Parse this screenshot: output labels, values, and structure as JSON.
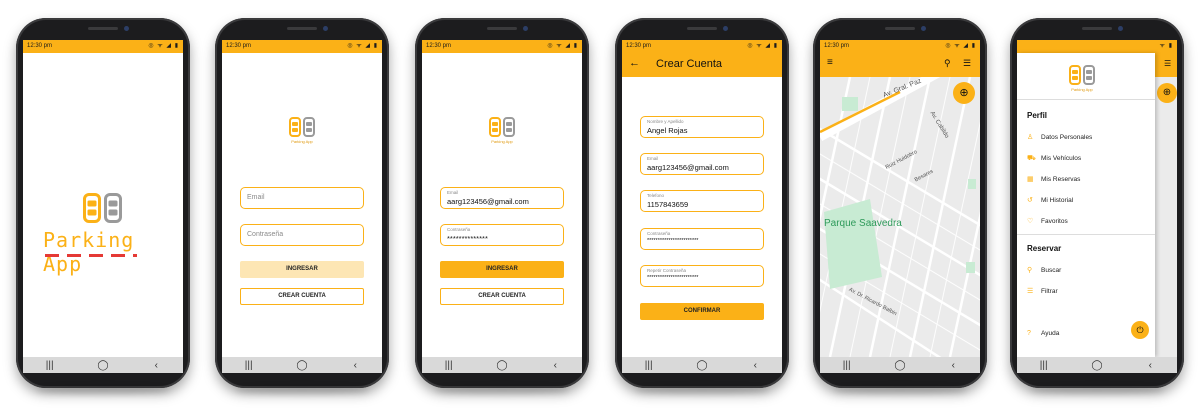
{
  "status": {
    "time": "12:30 pm",
    "icons": "◎ ᯤ ◢ ▮"
  },
  "nav": {
    "recents": "|||",
    "home": "◯",
    "back": "‹"
  },
  "logo": {
    "app_name": "Parking App",
    "caption": "Parking App"
  },
  "login": {
    "email_placeholder": "Email",
    "password_placeholder": "Contraseña",
    "login_button": "INGRESAR",
    "create_button": "CREAR CUENTA"
  },
  "login_filled": {
    "email_label": "Email",
    "email_value": "aarg123456@gmail.com",
    "password_label": "Contraseña",
    "password_value": "**************",
    "login_button": "INGRESAR",
    "create_button": "CREAR CUENTA"
  },
  "register": {
    "title": "Crear Cuenta",
    "name_label": "Nombre y Apellido",
    "name_value": "Angel Rojas",
    "email_label": "Email",
    "email_value": "aarg123456@gmail.com",
    "phone_label": "Telefono",
    "phone_value": "1157843659",
    "password_label": "Contraseña",
    "password_value": "************************",
    "repeat_label": "Repetir Contraseña",
    "repeat_value": "************************",
    "confirm_button": "CONFIRMAR"
  },
  "map": {
    "street_1": "Av. Gral. Paz",
    "street_2": "Av. Cabildo",
    "street_3": "Ruiz Huidobro",
    "street_4": "Besares",
    "park": "Parque Saavedra",
    "street_5": "Av. Dr. Ricardo Balbin"
  },
  "drawer": {
    "section_profile": "Perfil",
    "items_profile": [
      "Datos Personales",
      "Mis Vehículos",
      "Mis Reservas",
      "Mi Historial",
      "Favoritos"
    ],
    "section_reserve": "Reservar",
    "items_reserve": [
      "Buscar",
      "Filtrar"
    ],
    "help": "Ayuda"
  },
  "colors": {
    "accent": "#fbb117",
    "map_bg": "#ebebeb",
    "park": "#c8ebd3"
  }
}
